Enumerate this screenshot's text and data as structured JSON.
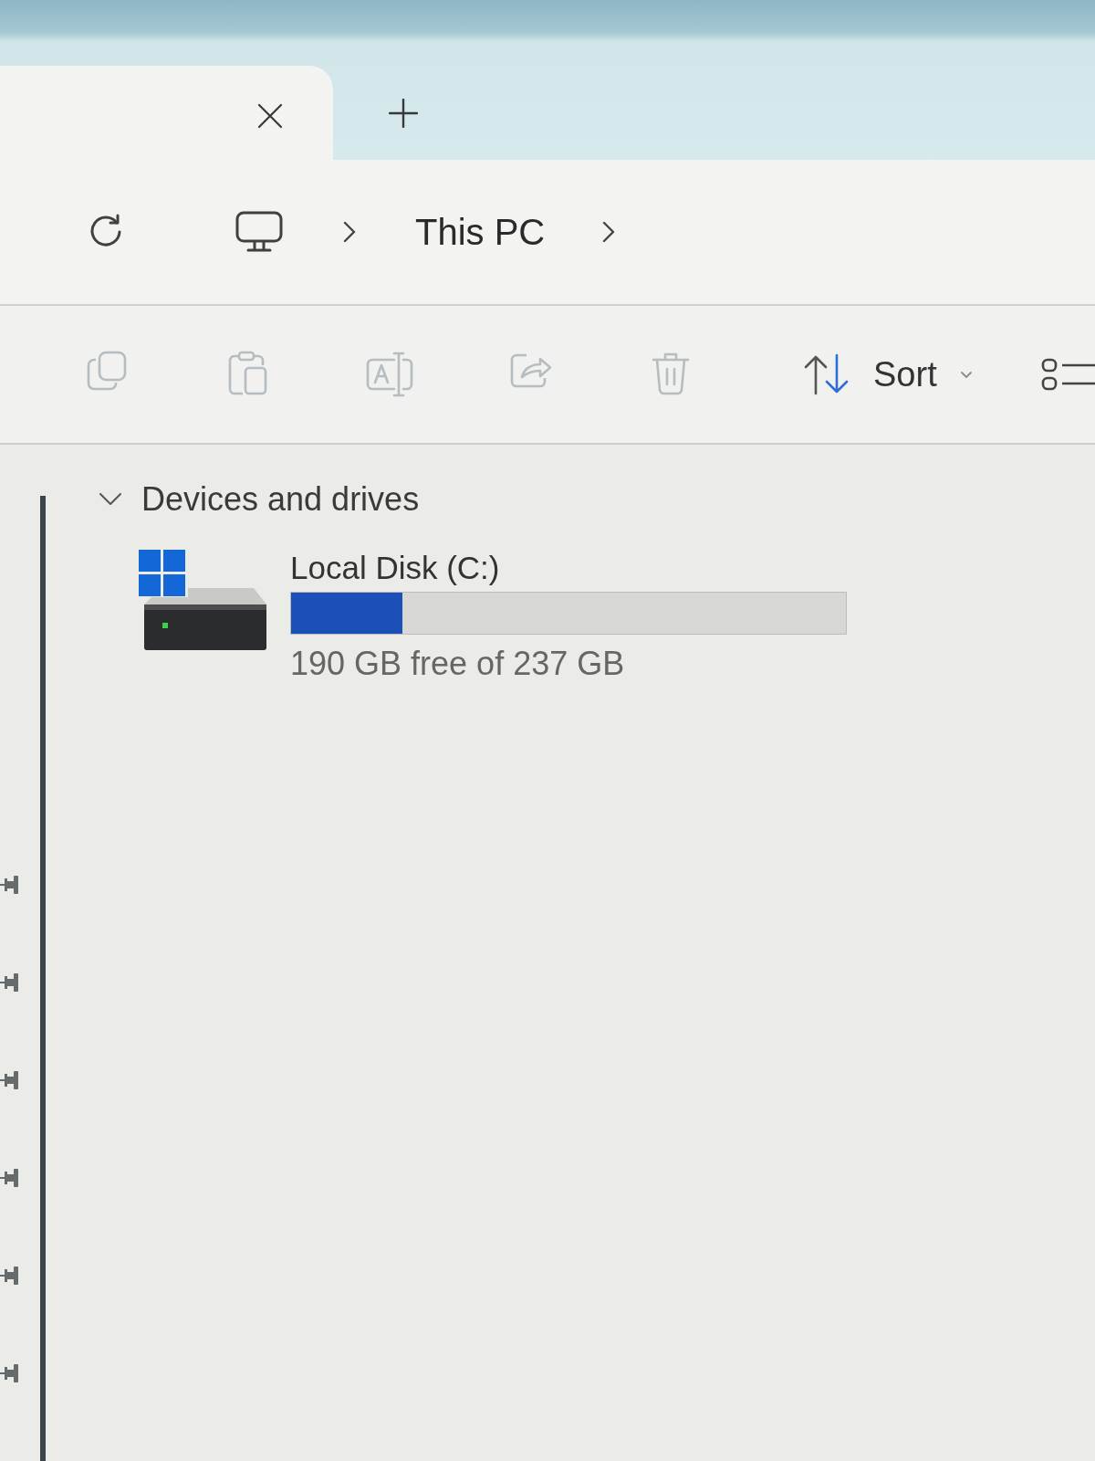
{
  "tabs": [
    {
      "selected": true
    }
  ],
  "address_bar": {
    "breadcrumbs": [
      "This PC"
    ]
  },
  "toolbar": {
    "actions": [
      {
        "disabled": true
      },
      {
        "disabled": true
      },
      {
        "disabled": true
      },
      {
        "disabled": true
      },
      {
        "disabled": true
      }
    ],
    "sort_button": {
      "label": "Sort"
    }
  },
  "navigation_pane": {
    "items": [
      {
        "pinned": true
      },
      {
        "pinned": true
      },
      {
        "pinned": true
      },
      {
        "pinned": true
      },
      {
        "pinned": true
      },
      {
        "pinned": true
      }
    ]
  },
  "sections": [
    {
      "title": "Devices and drives",
      "expanded": true,
      "drives": [
        {
          "name": "Local Disk (C:)",
          "level": 0.2,
          "reading": "190 GB free of 237 GB"
        }
      ]
    }
  ]
}
